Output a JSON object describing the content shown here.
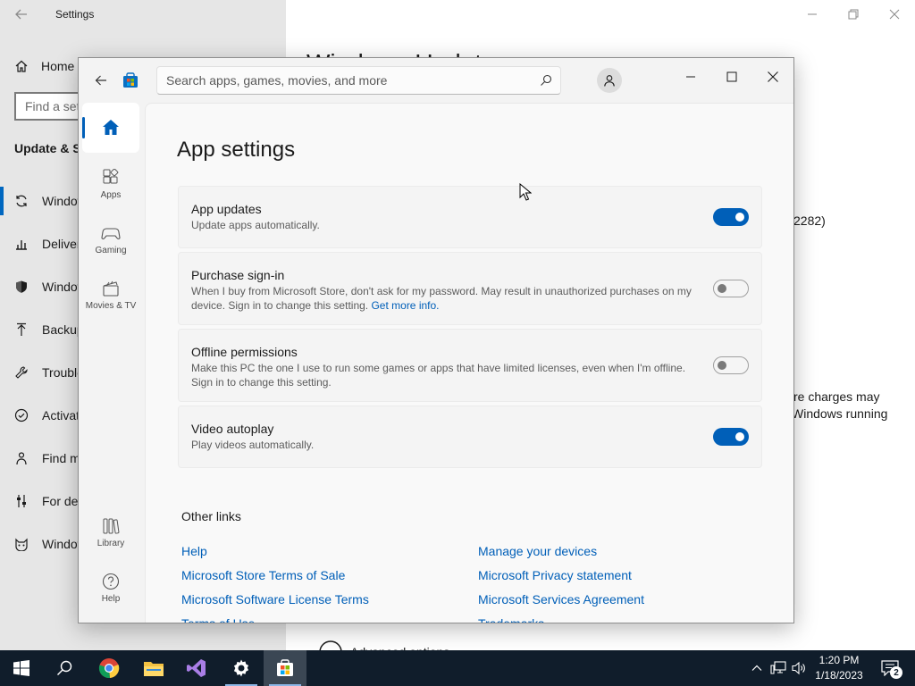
{
  "settings_window": {
    "title": "Settings",
    "home_label": "Home",
    "find_placeholder": "Find a setting",
    "section_title": "Update & Security",
    "nav_items": [
      {
        "label": "Windows Update",
        "icon": "sync-icon",
        "active": true
      },
      {
        "label": "Delivery Optimization",
        "icon": "delivery-icon"
      },
      {
        "label": "Windows Security",
        "icon": "shield-icon"
      },
      {
        "label": "Backup",
        "icon": "backup-arrow-icon"
      },
      {
        "label": "Troubleshoot",
        "icon": "wrench-icon"
      },
      {
        "label": "Activation",
        "icon": "check-circle-icon"
      },
      {
        "label": "Find my device",
        "icon": "person-pin-icon"
      },
      {
        "label": "For developers",
        "icon": "developer-slider-icon"
      },
      {
        "label": "Windows Insider Program",
        "icon": "insider-cat-icon"
      }
    ],
    "main_title": "Windows Update",
    "main_text_version": "2282)",
    "main_text_line1": "re charges may",
    "main_text_line2": "Windows running",
    "advanced_options": "Advanced options"
  },
  "store_window": {
    "search_placeholder": "Search apps, games, movies, and more",
    "nav": {
      "home": "Home",
      "apps": "Apps",
      "gaming": "Gaming",
      "movies": "Movies & TV",
      "library": "Library",
      "help": "Help"
    },
    "page_title": "App settings",
    "settings": [
      {
        "title": "App updates",
        "desc": "Update apps automatically.",
        "on": true
      },
      {
        "title": "Purchase sign-in",
        "desc": "When I buy from Microsoft Store, don't ask for my password. May result in unauthorized purchases on my device. Sign in to change this setting.",
        "link": "Get more info.",
        "on": false
      },
      {
        "title": "Offline permissions",
        "desc": "Make this PC the one I use to run some games or apps that have limited licenses, even when I'm offline. Sign in to change this setting.",
        "on": false
      },
      {
        "title": "Video autoplay",
        "desc": "Play videos automatically.",
        "on": true
      }
    ],
    "other_links_title": "Other links",
    "links_left": [
      "Help",
      "Microsoft Store Terms of Sale",
      "Microsoft Software License Terms",
      "Terms of Use"
    ],
    "links_right": [
      "Manage your devices",
      "Microsoft Privacy statement",
      "Microsoft Services Agreement",
      "Trademarks"
    ]
  },
  "taskbar": {
    "time": "1:20 PM",
    "date": "1/18/2023",
    "notification_count": "2"
  },
  "colors": {
    "accent": "#005fb8",
    "taskbar": "#101d2b"
  }
}
